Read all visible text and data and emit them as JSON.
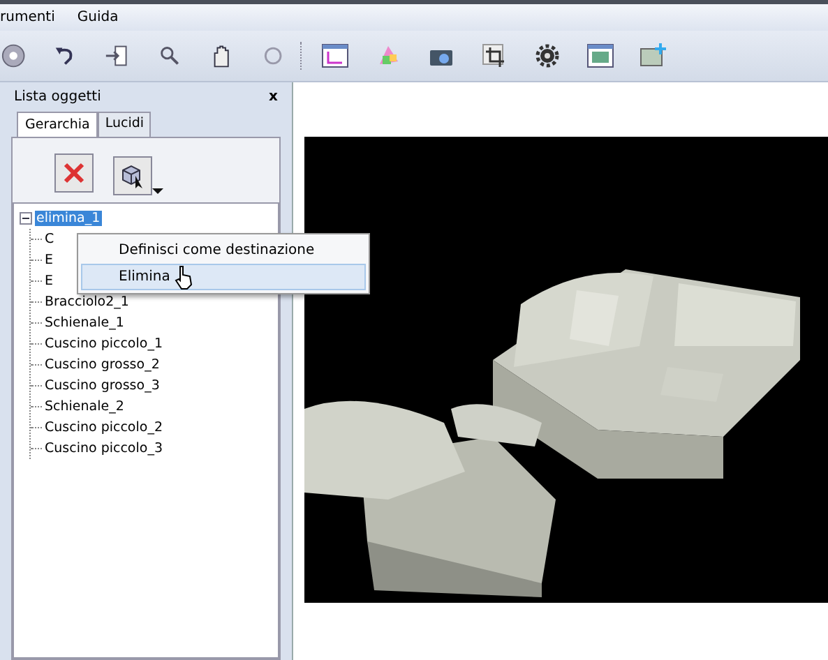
{
  "menu_bar": [
    "rumenti",
    "Guida"
  ],
  "panel": {
    "title": "Lista oggetti",
    "close": "x",
    "tabs": [
      {
        "label": "Gerarchia",
        "selected": true
      },
      {
        "label": "Lucidi",
        "selected": false
      }
    ],
    "tree": [
      {
        "label": "elimina_1",
        "selected": true,
        "expanded": true,
        "children": [
          {
            "label": "C",
            "selected": false
          },
          {
            "label": "E",
            "selected": false
          },
          {
            "label": "E",
            "selected": false
          },
          {
            "label": "Bracciolo2_1",
            "selected": false
          },
          {
            "label": "Schienale_1",
            "selected": false
          },
          {
            "label": "Cuscino piccolo_1",
            "selected": false
          },
          {
            "label": "Cuscino grosso_2",
            "selected": false
          },
          {
            "label": "Cuscino grosso_3",
            "selected": false
          },
          {
            "label": "Schienale_2",
            "selected": false
          },
          {
            "label": "Cuscino piccolo_2",
            "selected": false
          },
          {
            "label": "Cuscino piccolo_3",
            "selected": false
          }
        ]
      }
    ]
  },
  "context_menu": [
    {
      "label": "Definisci come destinazione",
      "selected": false
    },
    {
      "label": "Elimina",
      "selected": true
    }
  ]
}
